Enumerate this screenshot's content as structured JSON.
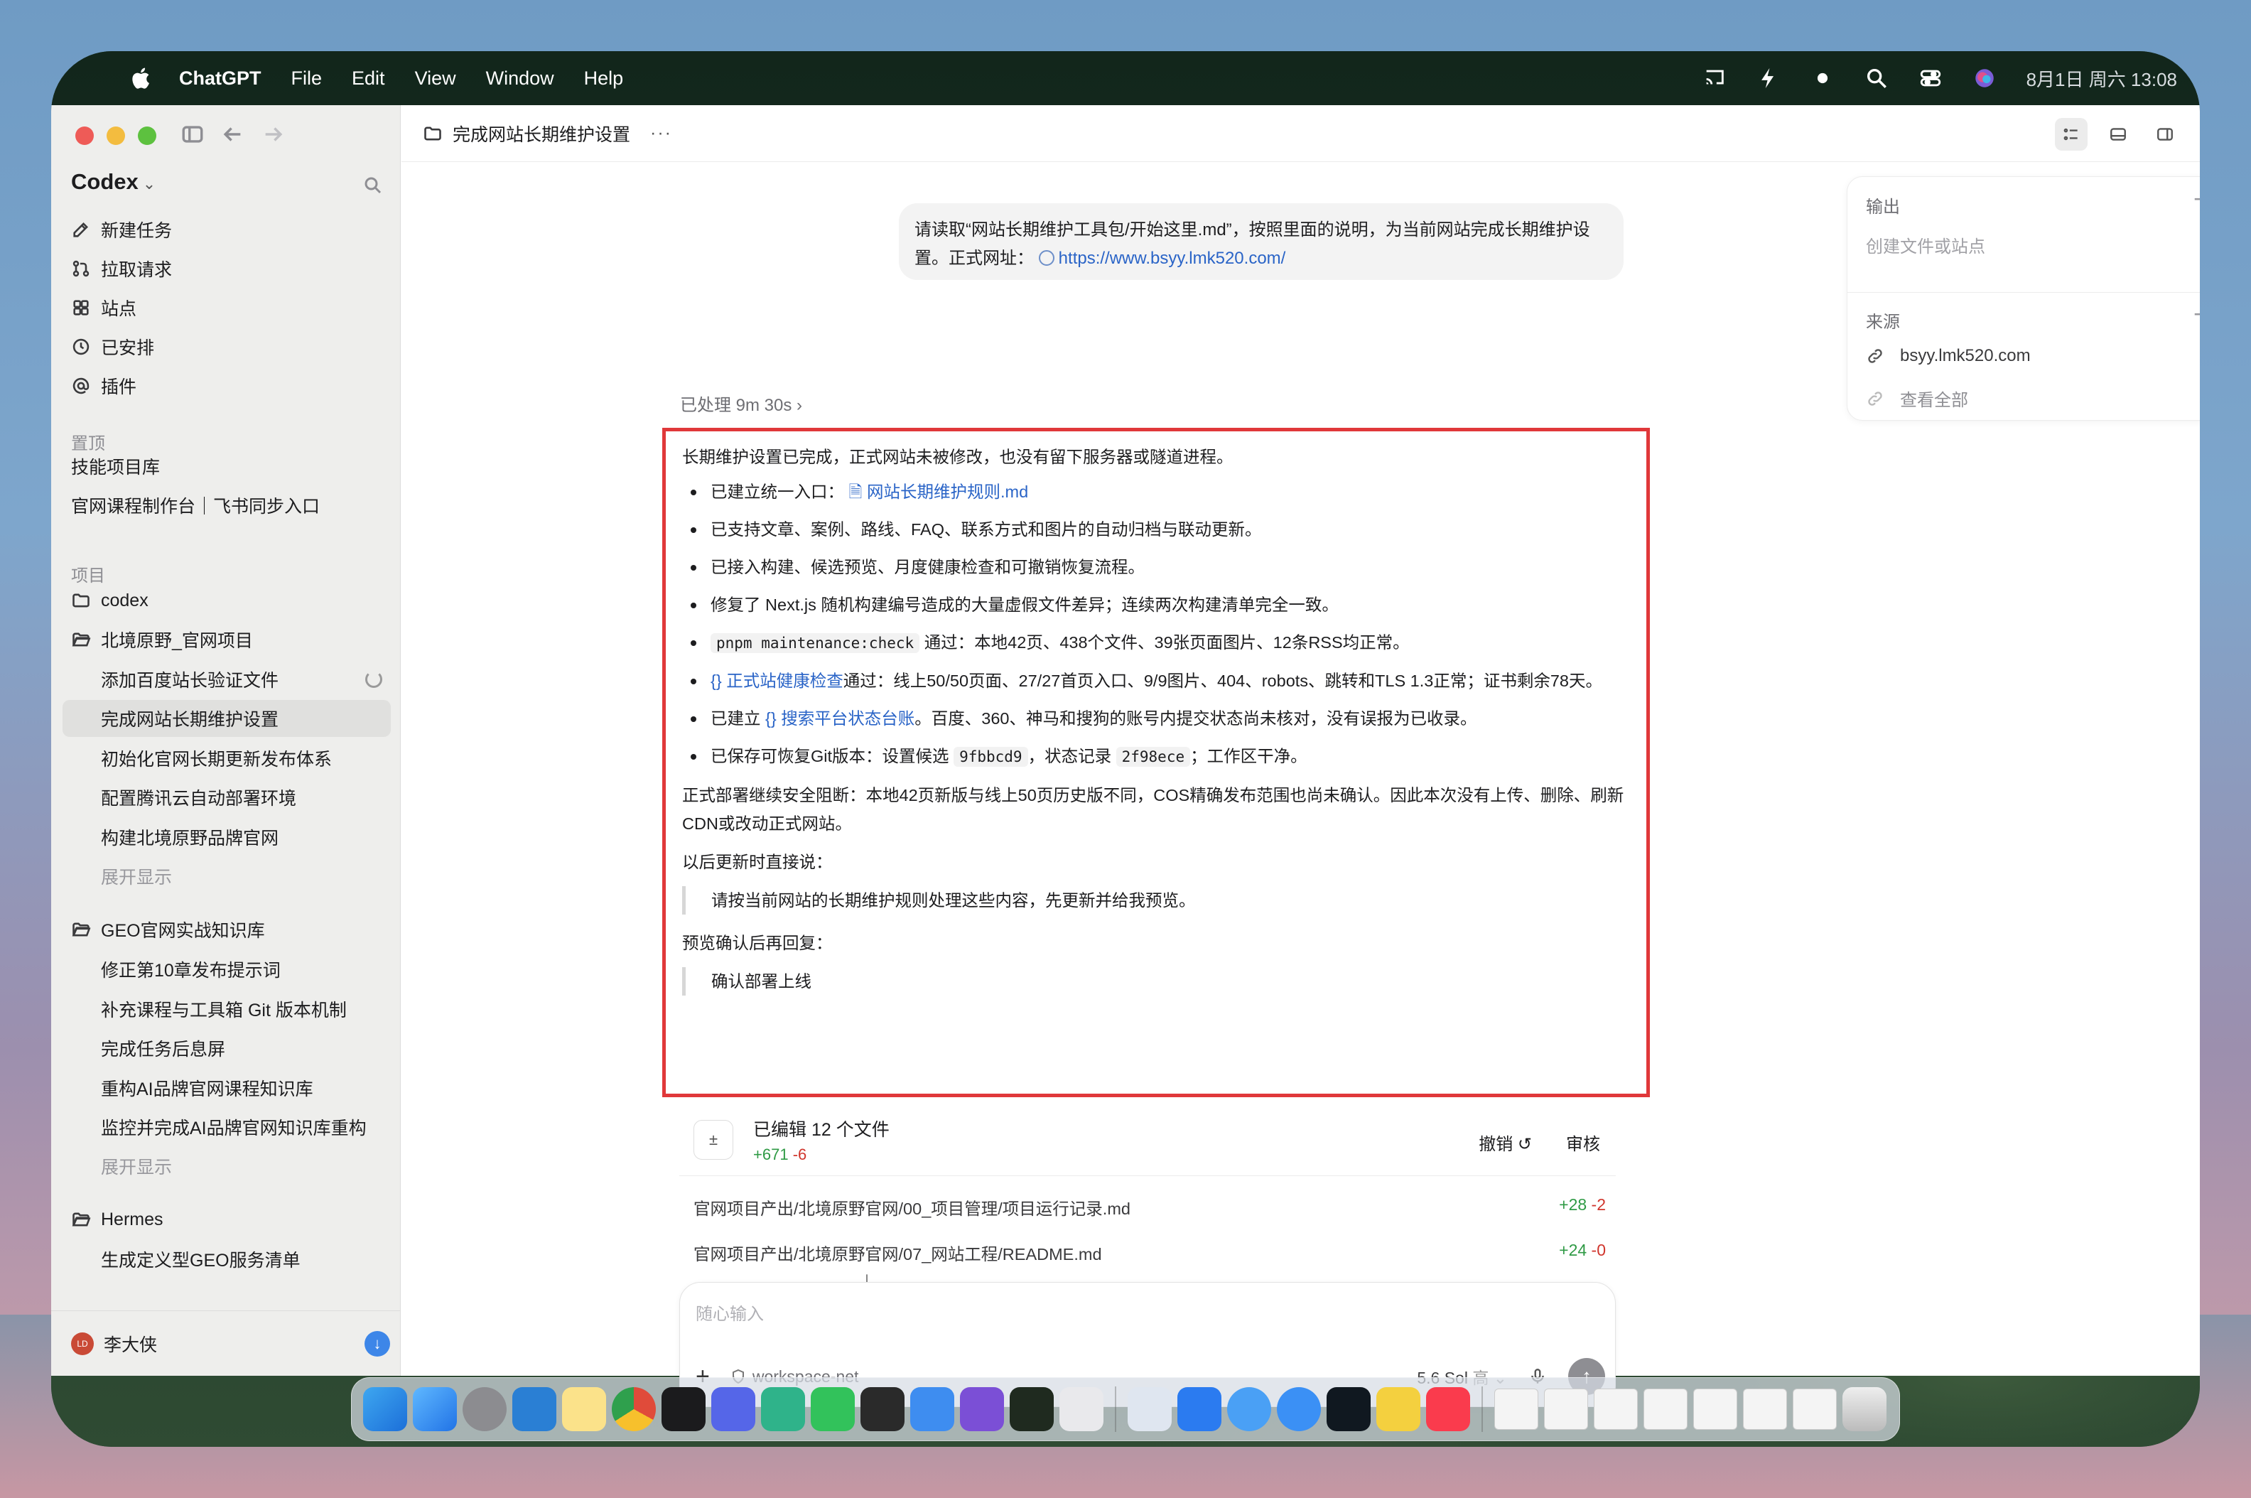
{
  "menubar": {
    "app": "ChatGPT",
    "items": [
      "File",
      "Edit",
      "View",
      "Window",
      "Help"
    ],
    "clock": "8月1日 周六 13:08"
  },
  "sidebar": {
    "title": "Codex",
    "nav": [
      {
        "label": "新建任务",
        "icon": "edit-icon"
      },
      {
        "label": "拉取请求",
        "icon": "pull-request-icon"
      },
      {
        "label": "站点",
        "icon": "grid-icon"
      },
      {
        "label": "已安排",
        "icon": "clock-icon"
      },
      {
        "label": "插件",
        "icon": "at-icon"
      }
    ],
    "pinned_label": "置顶",
    "pinned": [
      "技能项目库",
      "官网课程制作台｜飞书同步入口"
    ],
    "projects_label": "项目",
    "projects": [
      {
        "name": "codex",
        "children": []
      },
      {
        "name": "北境原野_官网项目",
        "children": [
          "添加百度站长验证文件",
          "完成网站长期维护设置",
          "初始化官网长期更新发布体系",
          "配置腾讯云自动部署环境",
          "构建北境原野品牌官网"
        ],
        "more": "展开显示"
      },
      {
        "name": "GEO官网实战知识库",
        "children": [
          "修正第10章发布提示词",
          "补充课程与工具箱 Git 版本机制",
          "完成任务后息屏",
          "重构AI品牌官网课程知识库",
          "监控并完成AI品牌官网知识库重构"
        ],
        "more": "展开显示"
      },
      {
        "name": "Hermes",
        "children": [
          "生成定义型GEO服务清单"
        ]
      }
    ],
    "user": {
      "name": "李大侠",
      "initials": "LD"
    }
  },
  "topbar": {
    "title": "完成网站长期维护设置",
    "more": "···"
  },
  "prompt": {
    "text": "请读取“网站长期维护工具包/开始这里.md”，按照里面的说明，为当前网站完成长期维护设置。正式网址：",
    "link": "https://www.bsyy.lmk520.com/"
  },
  "processed": "已处理 9m 30s",
  "answer": {
    "intro": "长期维护设置已完成，正式网站未被修改，也没有留下服务器或隧道进程。",
    "b1_pre": "已建立统一入口：",
    "b1_link": "网站长期维护规则.md",
    "b2": "已支持文章、案例、路线、FAQ、联系方式和图片的自动归档与联动更新。",
    "b3": "已接入构建、候选预览、月度健康检查和可撤销恢复流程。",
    "b4": "修复了 Next.js 随机构建编号造成的大量虚假文件差异；连续两次构建清单完全一致。",
    "b5_code": "pnpm maintenance:check",
    "b5_rest": "通过：本地42页、438个文件、39张页面图片、12条RSS均正常。",
    "b6_link": "正式站健康检查",
    "b6_rest": "通过：线上50/50页面、27/27首页入口、9/9图片、404、robots、跳转和TLS 1.3正常；证书剩余78天。",
    "b7_pre": "已建立",
    "b7_link": "搜索平台状态台账",
    "b7_rest": "。百度、360、神马和搜狗的账号内提交状态尚未核对，没有误报为已收录。",
    "b8_pre": "已保存可恢复Git版本：设置候选",
    "b8_code1": "9fbbcd9",
    "b8_mid": "，状态记录",
    "b8_code2": "2f98ece",
    "b8_end": "；工作区干净。",
    "para": "正式部署继续安全阻断：本地42页新版与线上50页历史版不同，COS精确发布范围也尚未确认。因此本次没有上传、删除、刷新CDN或改动正式网站。",
    "h1": "以后更新时直接说：",
    "q1": "请按当前网站的长期维护规则处理这些内容，先更新并给我预览。",
    "h2": "预览确认后再回复：",
    "q2": "确认部署上线"
  },
  "edits": {
    "title": "已编辑 12 个文件",
    "plus": "+671",
    "minus": "-6",
    "undo": "撤销 ↺",
    "review": "审核",
    "files": [
      {
        "path": "官网项目产出/北境原野官网/00_项目管理/项目运行记录.md",
        "plus": "+28",
        "minus": "-2"
      },
      {
        "path": "官网项目产出/北境原野官网/07_网站工程/README.md",
        "plus": "+24",
        "minus": "-0"
      }
    ]
  },
  "composer": {
    "placeholder": "随心输入",
    "workspace": "workspace-net",
    "model": "5.6 Sol",
    "effort": "高"
  },
  "panel": {
    "output_label": "输出",
    "output_hint": "创建文件或站点",
    "source_label": "来源",
    "source_item": "bsyy.lmk520.com",
    "view_all": "查看全部"
  },
  "colors": {
    "accent": "#2a64c7",
    "highlight_border": "#e0383a",
    "plus": "#2f9a45",
    "minus": "#d0352c"
  }
}
